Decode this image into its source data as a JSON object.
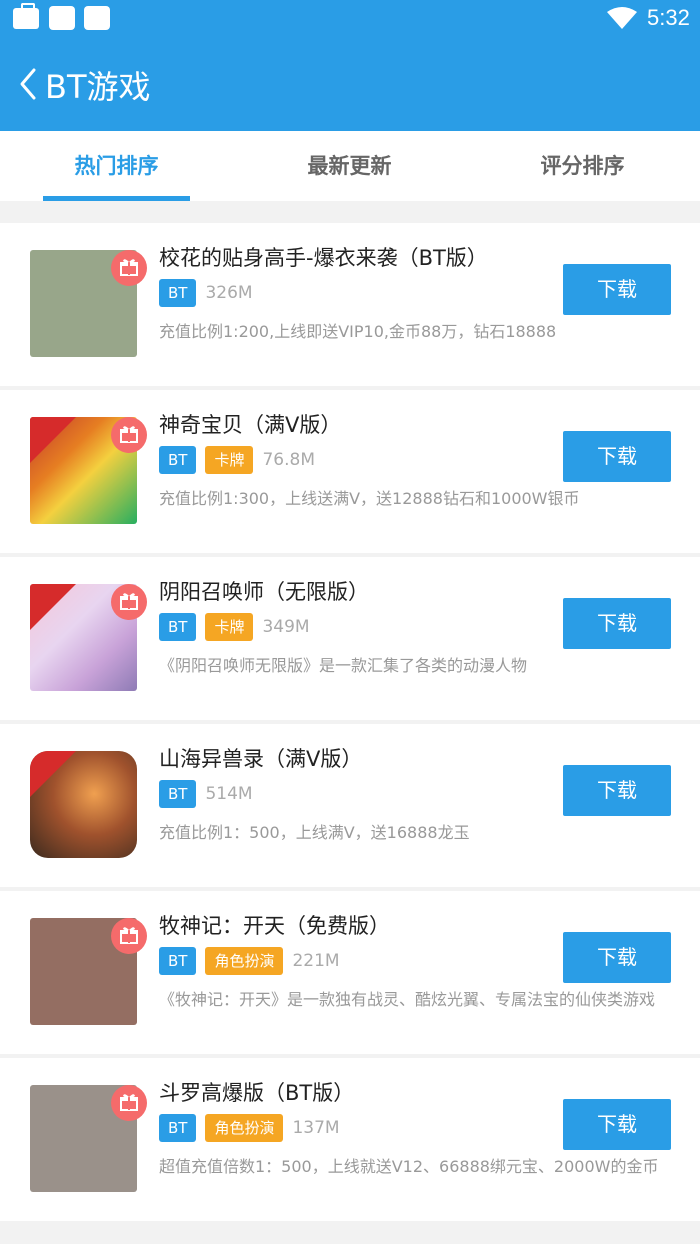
{
  "statusbar": {
    "time": "5:32"
  },
  "appbar": {
    "title": "BT游戏"
  },
  "tabs": [
    {
      "label": "热门排序",
      "active": true
    },
    {
      "label": "最新更新",
      "active": false
    },
    {
      "label": "评分排序",
      "active": false
    }
  ],
  "games": [
    {
      "name": "校花的贴身高手-爆衣来袭（BT版）",
      "tag": "BT",
      "category": "",
      "size": "326M",
      "desc": "充值比例1:200,上线即送VIP10,金币88万，钻石18888",
      "download": "下载",
      "icon_color": "#98a68a"
    },
    {
      "name": "神奇宝贝（满V版）",
      "tag": "BT",
      "category": "卡牌",
      "size": "76.8M",
      "desc": "充值比例1:300，上线送满V，送12888钻石和1000W银币",
      "download": "下载",
      "icon_color": ""
    },
    {
      "name": "阴阳召唤师（无限版）",
      "tag": "BT",
      "category": "卡牌",
      "size": "349M",
      "desc": "《阴阳召唤师无限版》是一款汇集了各类的动漫人物",
      "download": "下载",
      "icon_color": ""
    },
    {
      "name": "山海异兽录（满V版）",
      "tag": "BT",
      "category": "",
      "size": "514M",
      "desc": "充值比例1：500，上线满V，送16888龙玉",
      "download": "下载",
      "icon_color": ""
    },
    {
      "name": "牧神记：开天（免费版）",
      "tag": "BT",
      "category": "角色扮演",
      "size": "221M",
      "desc": "《牧神记：开天》是一款独有战灵、酷炫光翼、专属法宝的仙侠类游戏",
      "download": "下载",
      "icon_color": "#946e62"
    },
    {
      "name": "斗罗高爆版（BT版）",
      "tag": "BT",
      "category": "角色扮演",
      "size": "137M",
      "desc": "超值充值倍数1：500，上线就送V12、66888绑元宝、2000W的金币",
      "download": "下载",
      "icon_color": "#9a918a"
    }
  ]
}
